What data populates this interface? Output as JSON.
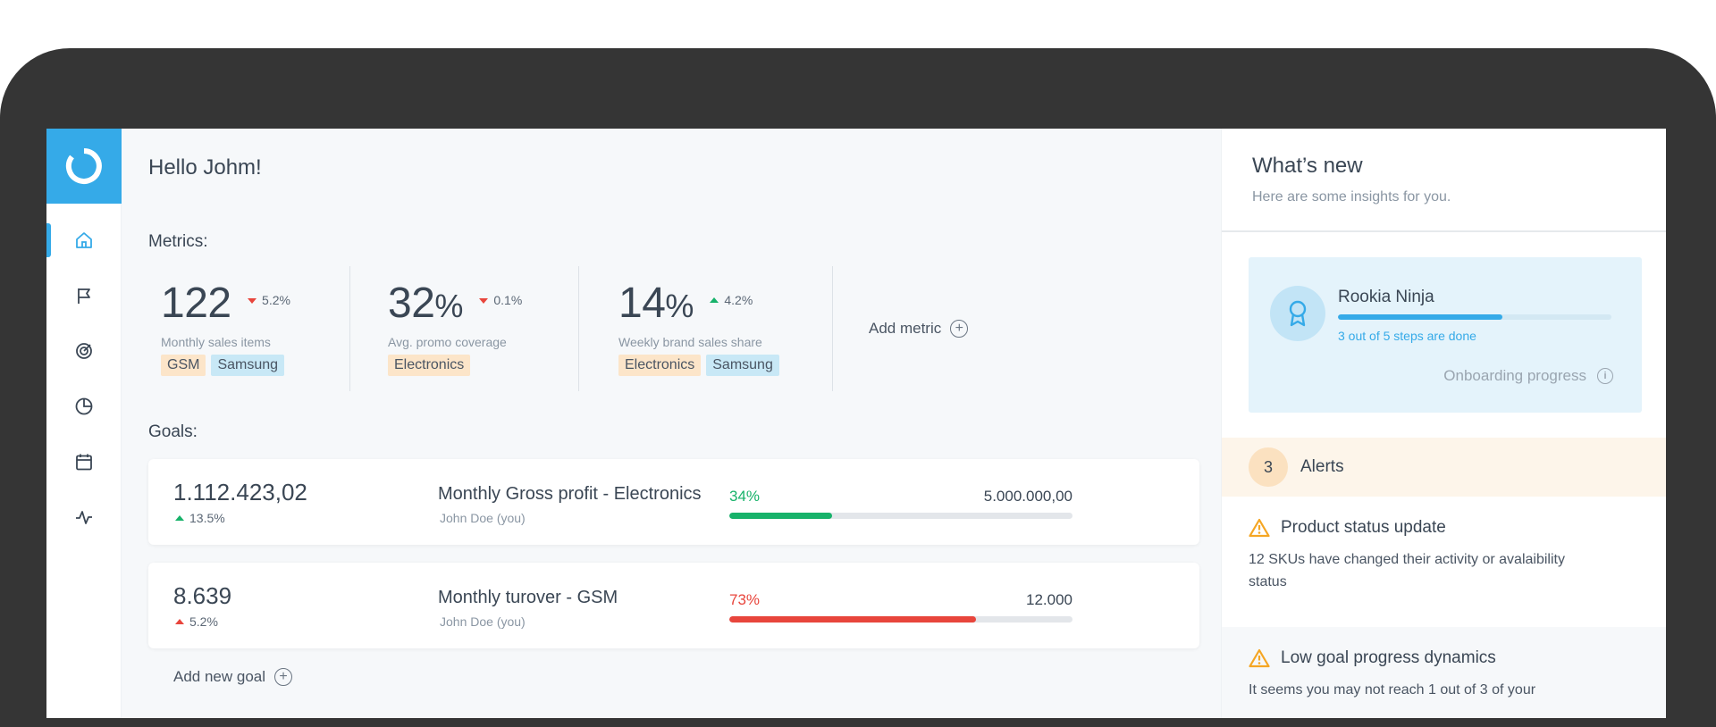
{
  "greeting": "Hello Johm!",
  "metrics_section": {
    "label": "Metrics:",
    "items": [
      {
        "value": "122",
        "unit": "",
        "delta": "5.2%",
        "direction": "down",
        "label": "Monthly sales items",
        "tags": [
          {
            "text": "GSM",
            "color": "orange"
          },
          {
            "text": "Samsung",
            "color": "blue"
          }
        ]
      },
      {
        "value": "32",
        "unit": "%",
        "delta": "0.1%",
        "direction": "down",
        "label": "Avg. promo coverage",
        "tags": [
          {
            "text": "Electronics",
            "color": "orange"
          }
        ]
      },
      {
        "value": "14",
        "unit": "%",
        "delta": "4.2%",
        "direction": "up",
        "label": "Weekly brand sales share",
        "tags": [
          {
            "text": "Electronics",
            "color": "orange"
          },
          {
            "text": "Samsung",
            "color": "blue"
          }
        ]
      }
    ],
    "add_label": "Add metric"
  },
  "goals_section": {
    "label": "Goals:",
    "items": [
      {
        "value": "1.112.423,02",
        "delta": "13.5%",
        "delta_color": "#17b26a",
        "title": "Monthly Gross profit - Electronics",
        "owner": "John Doe (you)",
        "percent": "34%",
        "progress": 0.3,
        "bar_color": "#17b26a",
        "target": "5.000.000,00"
      },
      {
        "value": "8.639",
        "delta": "5.2%",
        "delta_color": "#e8453c",
        "title": "Monthly turover - GSM",
        "owner": "John Doe (you)",
        "percent": "73%",
        "progress": 0.72,
        "bar_color": "#e8453c",
        "target": "12.000"
      }
    ],
    "add_label": "Add new goal"
  },
  "whats_new": {
    "title": "What’s new",
    "subtitle": "Here are some insights for you.",
    "onboarding": {
      "title": "Rookia Ninja",
      "steps": "3 out of 5 steps are done",
      "progress": 0.6,
      "caption": "Onboarding progress"
    },
    "alerts": {
      "count": "3",
      "label": "Alerts",
      "items": [
        {
          "title": "Product status update",
          "text": "12 SKUs have changed their activity or avalaibility status"
        },
        {
          "title": "Low goal progress dynamics",
          "text": "It seems you may not reach 1 out of 3 of your"
        }
      ]
    }
  },
  "colors": {
    "accent": "#35aae8",
    "green": "#17b26a",
    "red": "#e8453c",
    "warning": "#f5a623"
  },
  "nav": [
    "home-icon",
    "flag-icon",
    "target-icon",
    "pie-chart-icon",
    "calendar-icon",
    "activity-icon"
  ]
}
